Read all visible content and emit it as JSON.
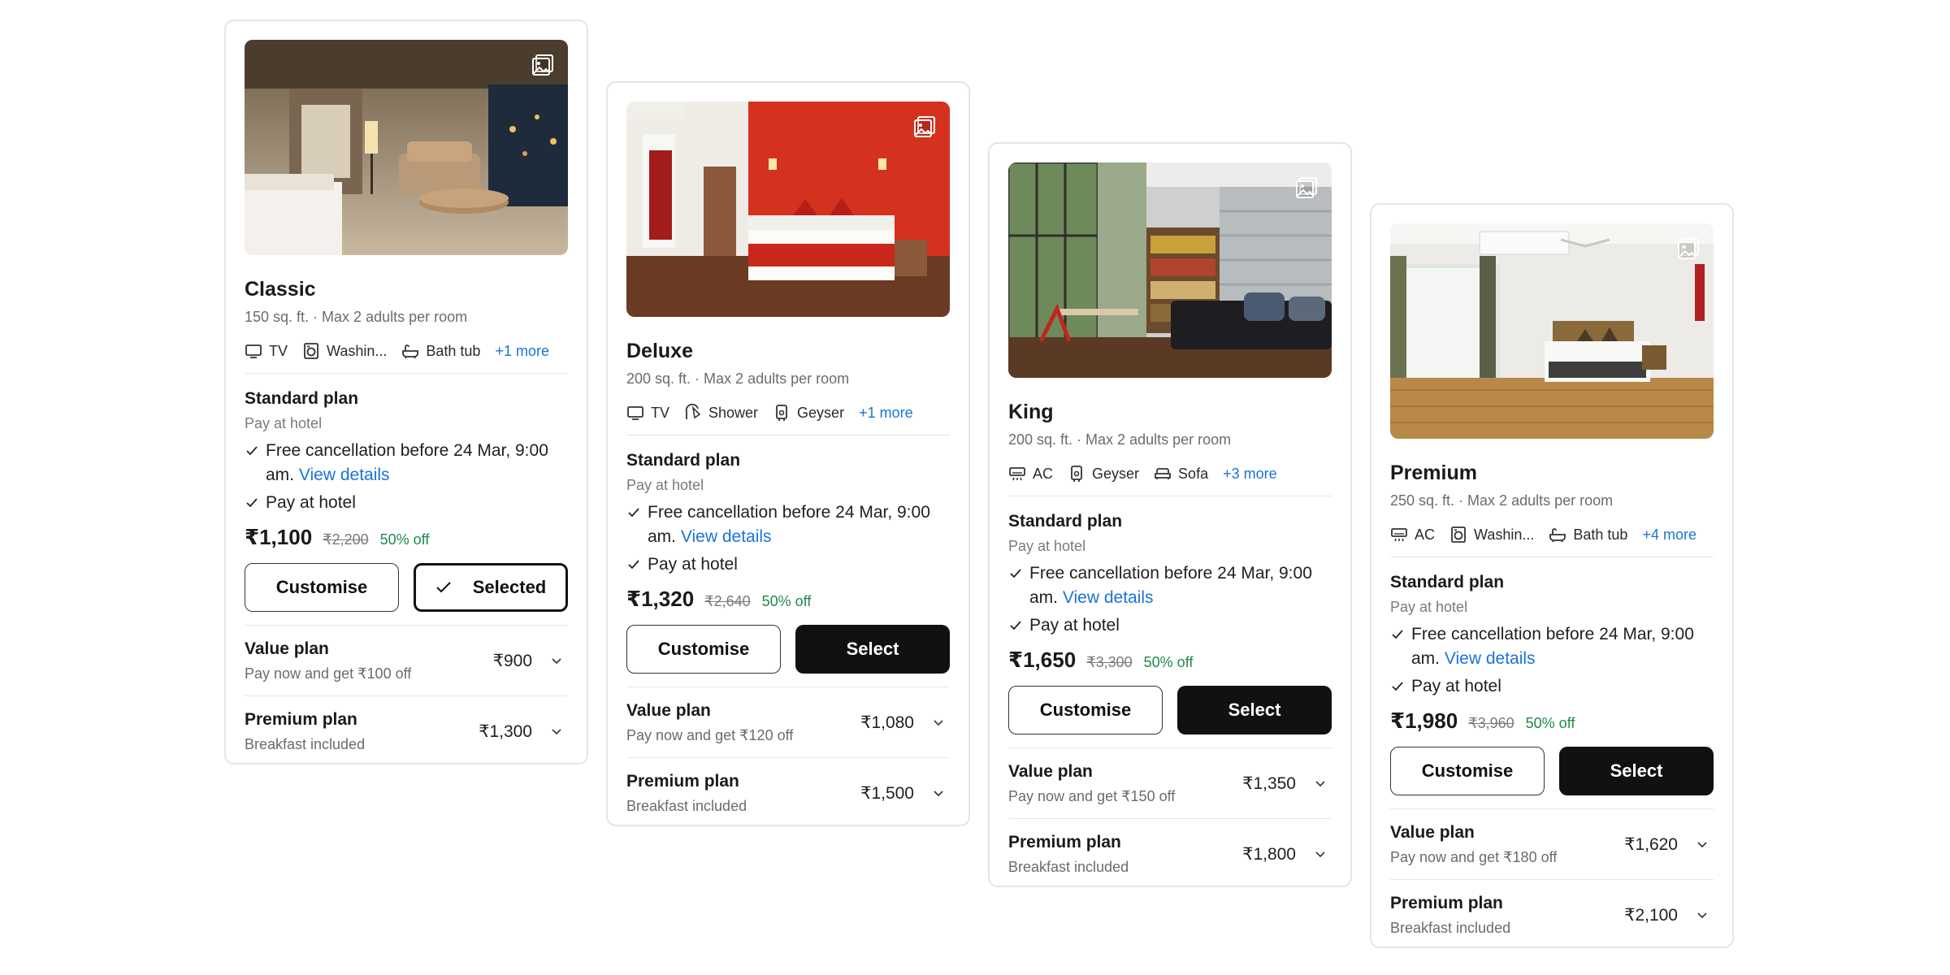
{
  "rooms": [
    {
      "name": "Classic",
      "meta": "150 sq. ft. · Max 2 adults per room",
      "amenities": [
        {
          "icon": "tv-icon",
          "label": "TV"
        },
        {
          "icon": "washing-machine-icon",
          "label": "Washin..."
        },
        {
          "icon": "bath-tub-icon",
          "label": "Bath tub"
        }
      ],
      "more": "+1 more",
      "plan_title": "Standard plan",
      "plan_sub": "Pay at hotel",
      "feature1": "Free cancellation before 24 Mar, 9:00 am.",
      "feature1_link": "View details",
      "feature2": "Pay at hotel",
      "price": "₹1,100",
      "old_price": "₹2,200",
      "discount": "50% off",
      "customise_label": "Customise",
      "select_label": "Selected",
      "value_plan_title": "Value plan",
      "value_plan_sub": "Pay now and get ₹100 off",
      "value_plan_price": "₹900",
      "premium_plan_title": "Premium plan",
      "premium_plan_sub": "Breakfast included",
      "premium_plan_price": "₹1,300"
    },
    {
      "name": "Deluxe",
      "meta": "200 sq. ft. · Max 2 adults per room",
      "amenities": [
        {
          "icon": "tv-icon",
          "label": "TV"
        },
        {
          "icon": "shower-icon",
          "label": "Shower"
        },
        {
          "icon": "geyser-icon",
          "label": "Geyser"
        }
      ],
      "more": "+1 more",
      "plan_title": "Standard plan",
      "plan_sub": "Pay at hotel",
      "feature1": "Free cancellation before 24 Mar, 9:00 am.",
      "feature1_link": "View details",
      "feature2": "Pay at hotel",
      "price": "₹1,320",
      "old_price": "₹2,640",
      "discount": "50% off",
      "customise_label": "Customise",
      "select_label": "Select",
      "value_plan_title": "Value plan",
      "value_plan_sub": "Pay now and get ₹120 off",
      "value_plan_price": "₹1,080",
      "premium_plan_title": "Premium plan",
      "premium_plan_sub": "Breakfast included",
      "premium_plan_price": "₹1,500"
    },
    {
      "name": "King",
      "meta": "200 sq. ft. · Max 2 adults per room",
      "amenities": [
        {
          "icon": "ac-icon",
          "label": "AC"
        },
        {
          "icon": "geyser-icon",
          "label": "Geyser"
        },
        {
          "icon": "sofa-icon",
          "label": "Sofa"
        }
      ],
      "more": "+3 more",
      "plan_title": "Standard plan",
      "plan_sub": "Pay at hotel",
      "feature1": "Free cancellation before 24 Mar, 9:00 am.",
      "feature1_link": "View details",
      "feature2": "Pay at hotel",
      "price": "₹1,650",
      "old_price": "₹3,300",
      "discount": "50% off",
      "customise_label": "Customise",
      "select_label": "Select",
      "value_plan_title": "Value plan",
      "value_plan_sub": "Pay now and get ₹150 off",
      "value_plan_price": "₹1,350",
      "premium_plan_title": "Premium plan",
      "premium_plan_sub": "Breakfast included",
      "premium_plan_price": "₹1,800"
    },
    {
      "name": "Premium",
      "meta": "250 sq. ft. · Max 2 adults per room",
      "amenities": [
        {
          "icon": "ac-icon",
          "label": "AC"
        },
        {
          "icon": "washing-machine-icon",
          "label": "Washin..."
        },
        {
          "icon": "bath-tub-icon",
          "label": "Bath tub"
        }
      ],
      "more": "+4 more",
      "plan_title": "Standard plan",
      "plan_sub": "Pay at hotel",
      "feature1": "Free cancellation before 24 Mar, 9:00 am.",
      "feature1_link": "View details",
      "feature2": "Pay at hotel",
      "price": "₹1,980",
      "old_price": "₹3,960",
      "discount": "50% off",
      "customise_label": "Customise",
      "select_label": "Select",
      "value_plan_title": "Value plan",
      "value_plan_sub": "Pay now and get ₹180 off",
      "value_plan_price": "₹1,620",
      "premium_plan_title": "Premium plan",
      "premium_plan_sub": "Breakfast included",
      "premium_plan_price": "₹2,100"
    }
  ],
  "colors": {
    "link": "#1a73d9",
    "discount": "#1e8a4c",
    "button_dark": "#111111",
    "border": "#e4e4e4"
  }
}
